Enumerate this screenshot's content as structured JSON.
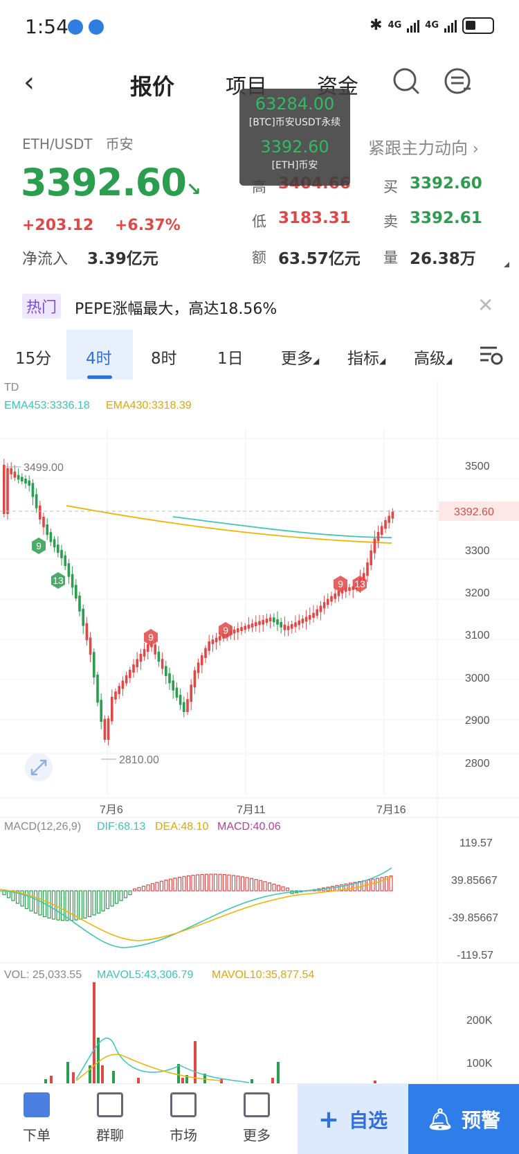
{
  "status": {
    "time": "1:54",
    "net1": "4G",
    "net2": "4G"
  },
  "nav": {
    "tabs": [
      "报价",
      "项目",
      "资金"
    ]
  },
  "tooltip": {
    "price1": "63284.00",
    "label1": "[BTC]币安USDT永续",
    "price2": "3392.60",
    "label2": "[ETH]币安"
  },
  "quote": {
    "pair": "ETH/USDT",
    "exchange": "币安",
    "price": "3392.60",
    "arrow": "↘",
    "change_abs": "+203.12",
    "change_pct": "+6.37%",
    "net_inflow_label": "净流入",
    "net_inflow_value": "3.39亿元",
    "follow_link": "紧跟主力动向",
    "high_label": "高",
    "high_value": "3404.66",
    "low_label": "低",
    "low_value": "3183.31",
    "amount_label": "额",
    "amount_value": "63.57亿元",
    "buy_label": "买",
    "buy_value": "3392.60",
    "sell_label": "卖",
    "sell_value": "3392.61",
    "volume_label": "量",
    "volume_value": "26.38万"
  },
  "hot": {
    "tag": "热门",
    "text": "PEPE涨幅最大，高达18.56%"
  },
  "intervals": {
    "tabs": [
      "15分",
      "4时",
      "8时",
      "1日",
      "更多",
      "指标",
      "高级"
    ],
    "active": "4时"
  },
  "chart": {
    "indicator": "TD",
    "ema1": "EMA453:3336.18",
    "ema2": "EMA430:3318.39",
    "high_mark": "3499.00",
    "low_mark": "2810.00",
    "last_price": "3392.60",
    "y_ticks": [
      "3500",
      "3300",
      "3200",
      "3100",
      "3000",
      "2900",
      "2800"
    ],
    "x_ticks": [
      "7月6",
      "7月11",
      "7月16"
    ],
    "td_labels": [
      "9",
      "13",
      "9",
      "9",
      "9",
      "13"
    ],
    "macd_header": "MACD(12,26,9)",
    "dif": "DIF:68.13",
    "dea": "DEA:48.10",
    "macd": "MACD:40.06",
    "macd_ticks": [
      "119.57",
      "39.85667",
      "-39.85667",
      "-119.57"
    ],
    "vol_header": "VOL: 25,033.55",
    "mavol5": "MAVOL5:43,306.79",
    "mavol10": "MAVOL10:35,877.54",
    "vol_ticks": [
      "200K",
      "100K"
    ]
  },
  "bottom": {
    "items": [
      "下单",
      "群聊",
      "市场",
      "更多"
    ],
    "fav": "自选",
    "alert": "预警"
  },
  "colors": {
    "up": "#e04848",
    "down": "#2a9d4e",
    "accent": "#2f6fe0",
    "ema1": "#39c6b8",
    "ema2": "#f0b400",
    "macd": "#c0399d"
  }
}
